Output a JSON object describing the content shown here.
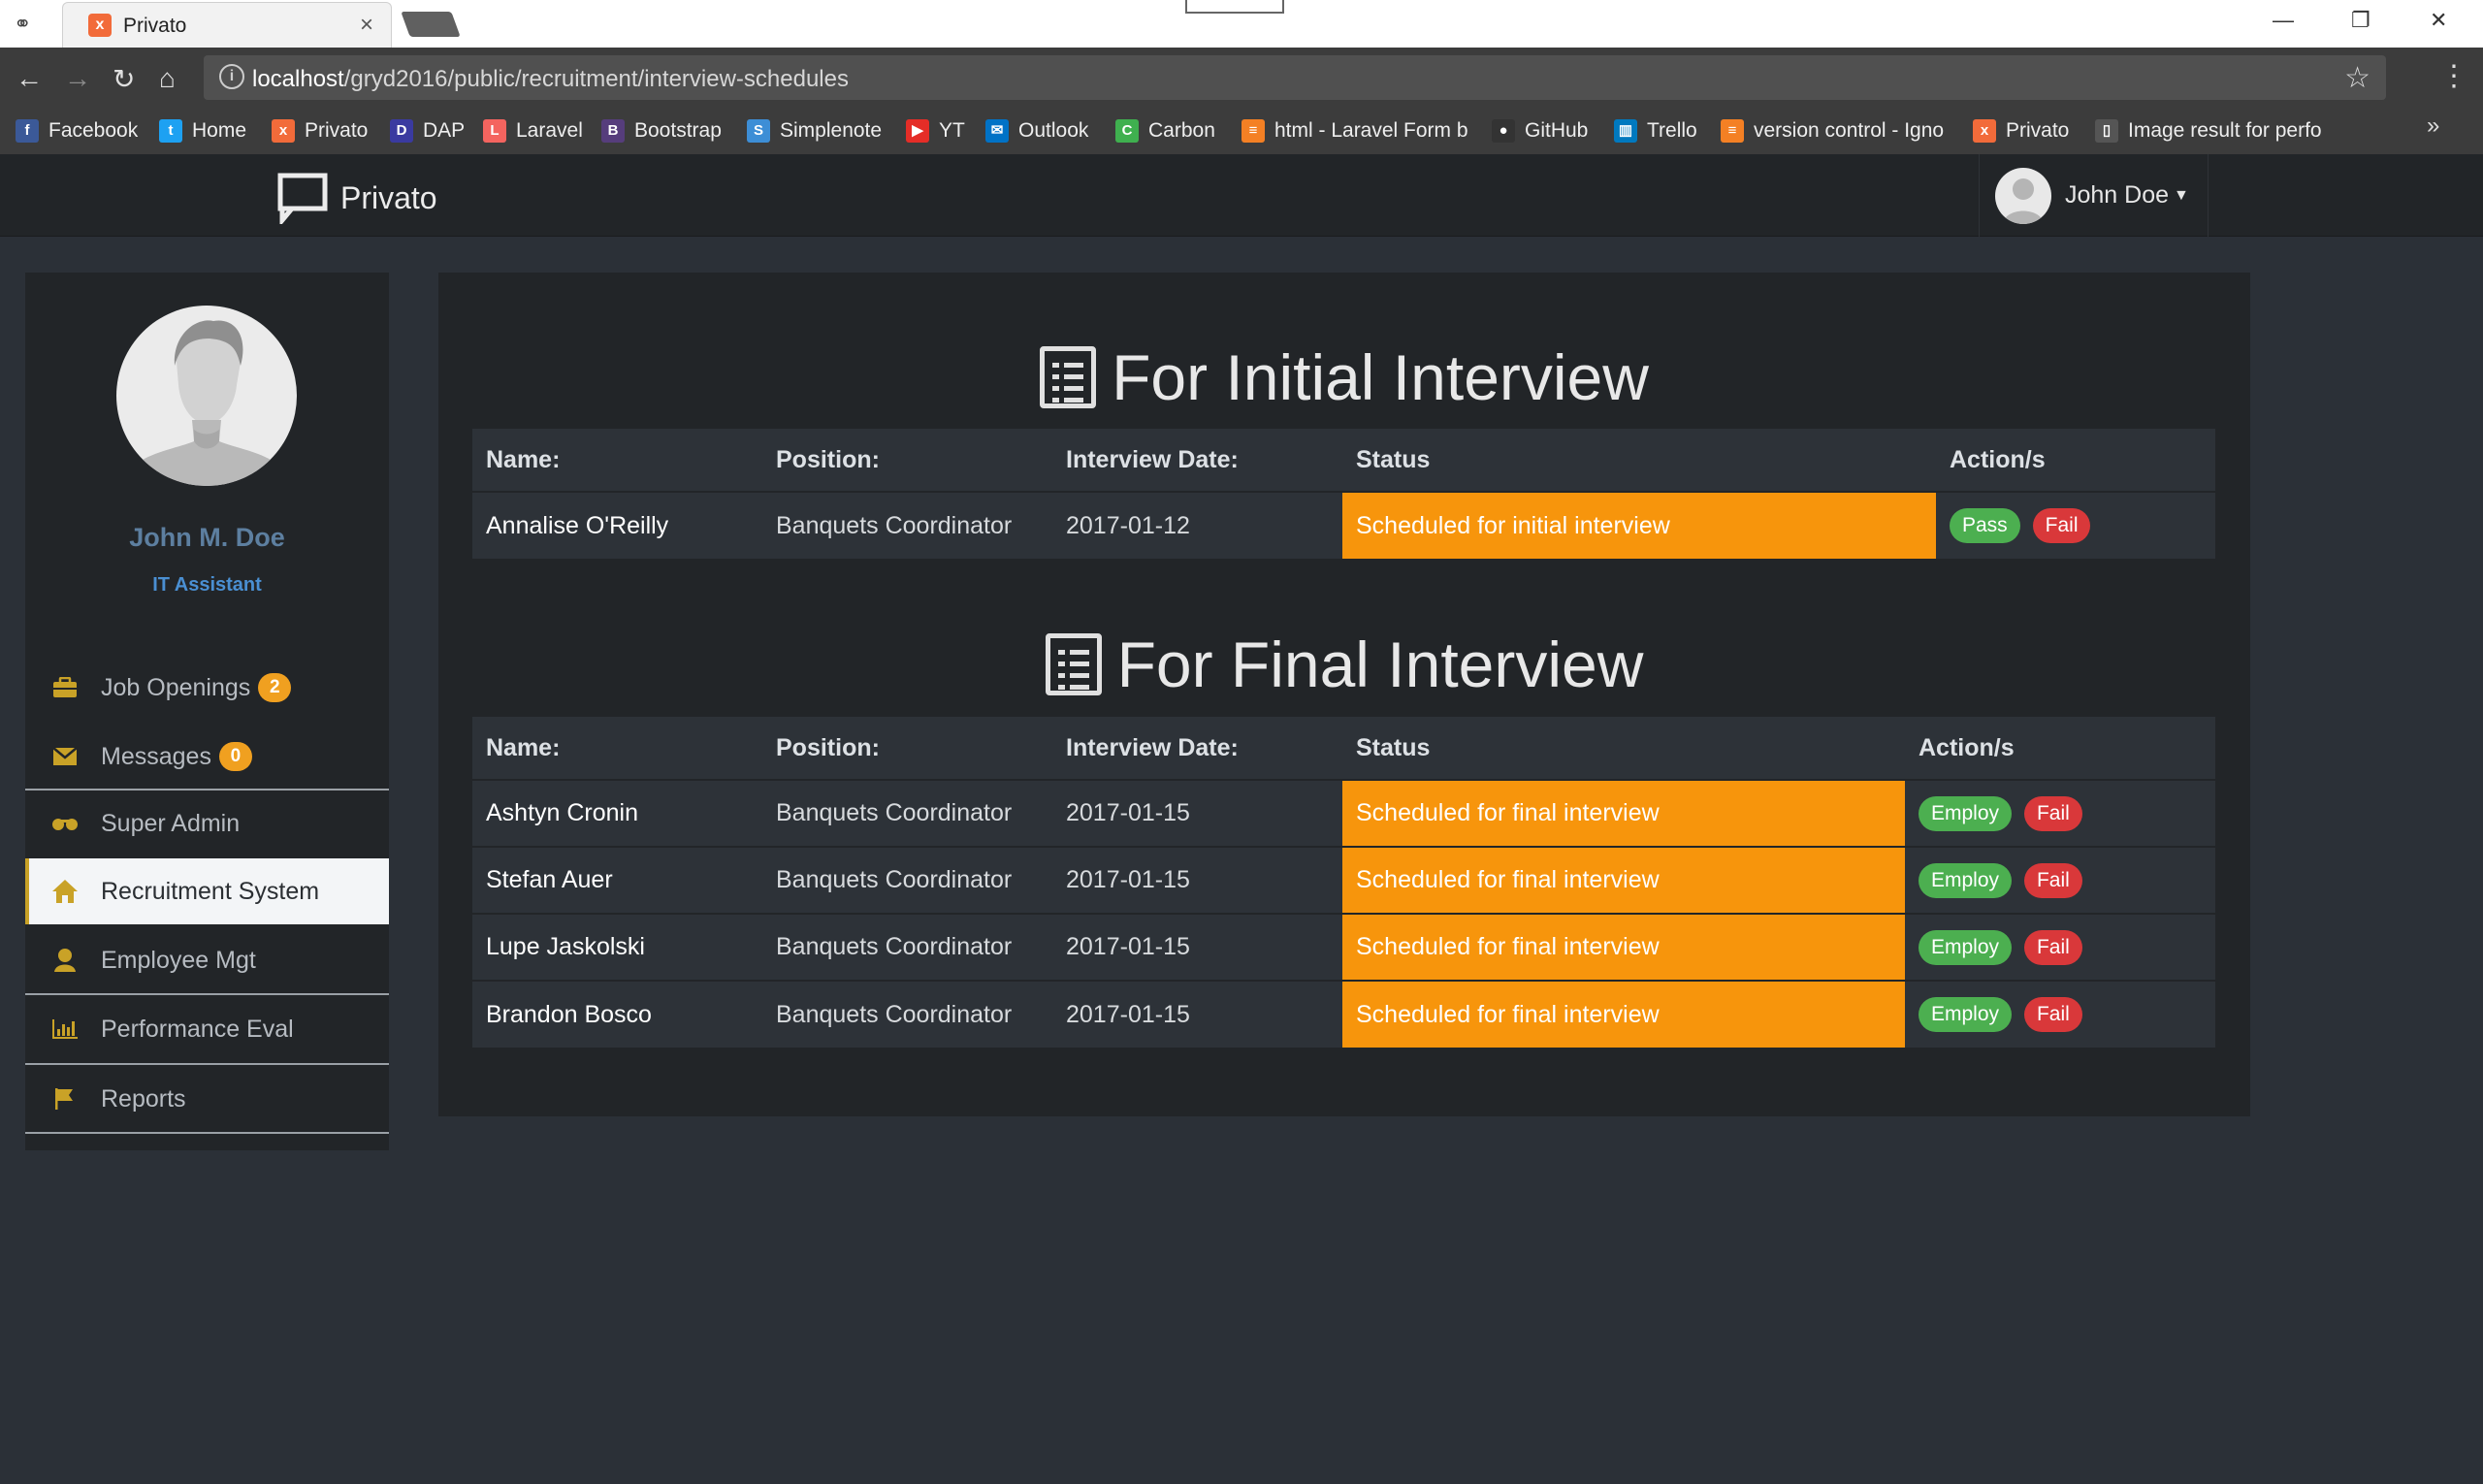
{
  "browser": {
    "tab_title": "Privato",
    "url_host": "localhost",
    "url_path": "/gryd2016/public/recruitment/interview-schedules",
    "bookmarks": [
      {
        "label": "Facebook",
        "icon": "facebook-icon",
        "color": "#3b5998",
        "glyph": "f"
      },
      {
        "label": "Home",
        "icon": "twitter-icon",
        "color": "#1da1f2",
        "glyph": "t"
      },
      {
        "label": "Privato",
        "icon": "xampp-icon",
        "color": "#f26b3a",
        "glyph": "x"
      },
      {
        "label": "DAP",
        "icon": "dap-icon",
        "color": "#3a3aa0",
        "glyph": "D"
      },
      {
        "label": "Laravel",
        "icon": "laravel-icon",
        "color": "#f4645f",
        "glyph": "L"
      },
      {
        "label": "Bootstrap",
        "icon": "bootstrap-icon",
        "color": "#563d7c",
        "glyph": "B"
      },
      {
        "label": "Simplenote",
        "icon": "simplenote-icon",
        "color": "#3d8ed6",
        "glyph": "S"
      },
      {
        "label": "YT",
        "icon": "youtube-icon",
        "color": "#e52d27",
        "glyph": "▶"
      },
      {
        "label": "Outlook",
        "icon": "outlook-icon",
        "color": "#0072c6",
        "glyph": "✉"
      },
      {
        "label": "Carbon",
        "icon": "carbon-icon",
        "color": "#3fb04f",
        "glyph": "C"
      },
      {
        "label": "html - Laravel Form b",
        "icon": "stackoverflow-icon",
        "color": "#f48024",
        "glyph": "≡"
      },
      {
        "label": "GitHub",
        "icon": "github-icon",
        "color": "#333333",
        "glyph": "●"
      },
      {
        "label": "Trello",
        "icon": "trello-icon",
        "color": "#0079bf",
        "glyph": "▥"
      },
      {
        "label": "version control - Igno",
        "icon": "stackoverflow-icon",
        "color": "#f48024",
        "glyph": "≡"
      },
      {
        "label": "Privato",
        "icon": "xampp-icon",
        "color": "#f26b3a",
        "glyph": "x"
      },
      {
        "label": "Image result for perfo",
        "icon": "page-icon",
        "color": "#555555",
        "glyph": "▯"
      }
    ]
  },
  "navbar": {
    "brand": "Privato",
    "user": "John Doe"
  },
  "sidebar": {
    "profile_name": "John M. Doe",
    "profile_role": "IT Assistant",
    "items": [
      {
        "label": "Job Openings",
        "badge": "2",
        "icon": "briefcase-icon"
      },
      {
        "label": "Messages",
        "badge": "0",
        "icon": "envelope-icon"
      },
      {
        "label": "Super Admin",
        "icon": "glasses-icon"
      },
      {
        "label": "Recruitment System",
        "icon": "home-icon"
      },
      {
        "label": "Employee Mgt",
        "icon": "user-icon"
      },
      {
        "label": "Performance Eval",
        "icon": "bar-chart-icon"
      },
      {
        "label": "Reports",
        "icon": "flag-icon"
      }
    ]
  },
  "initial": {
    "heading": "For Initial Interview",
    "headers": [
      "Name:",
      "Position:",
      "Interview Date:",
      "Status",
      "Action/s"
    ],
    "rows": [
      {
        "name": "Annalise O'Reilly",
        "position": "Banquets Coordinator",
        "date": "2017-01-12",
        "status": "Scheduled for initial interview",
        "pass": "Pass",
        "fail": "Fail"
      }
    ]
  },
  "final": {
    "heading": "For Final Interview",
    "headers": [
      "Name:",
      "Position:",
      "Interview Date:",
      "Status",
      "Action/s"
    ],
    "rows": [
      {
        "name": "Ashtyn Cronin",
        "position": "Banquets Coordinator",
        "date": "2017-01-15",
        "status": "Scheduled for final interview",
        "employ": "Employ",
        "fail": "Fail"
      },
      {
        "name": "Stefan Auer",
        "position": "Banquets Coordinator",
        "date": "2017-01-15",
        "status": "Scheduled for final interview",
        "employ": "Employ",
        "fail": "Fail"
      },
      {
        "name": "Lupe Jaskolski",
        "position": "Banquets Coordinator",
        "date": "2017-01-15",
        "status": "Scheduled for final interview",
        "employ": "Employ",
        "fail": "Fail"
      },
      {
        "name": "Brandon Bosco",
        "position": "Banquets Coordinator",
        "date": "2017-01-15",
        "status": "Scheduled for final interview",
        "employ": "Employ",
        "fail": "Fail"
      }
    ]
  }
}
